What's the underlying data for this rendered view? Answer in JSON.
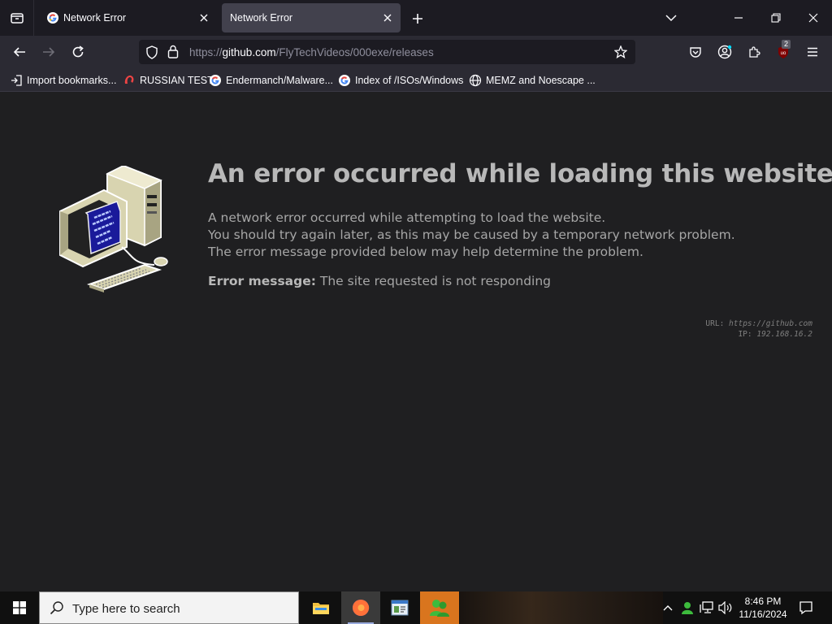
{
  "browser": {
    "tabs": [
      {
        "title": "Network Error",
        "active": false
      },
      {
        "title": "Network Error",
        "active": true
      }
    ],
    "url": {
      "scheme": "https://",
      "host": "github.com",
      "path": "/FlyTechVideos/000exe/releases"
    },
    "bookmarks": [
      {
        "label": "Import bookmarks...",
        "icon": "import-icon"
      },
      {
        "label": "RUSSIAN TEST",
        "icon": "site-icon"
      },
      {
        "label": "Endermanch/Malware...",
        "icon": "google-icon"
      },
      {
        "label": "Index of /ISOs/Windows",
        "icon": "google-icon"
      },
      {
        "label": "MEMZ and Noescape ...",
        "icon": "globe-icon"
      }
    ],
    "extension_badge": "2"
  },
  "error_page": {
    "heading": "An error occurred while loading this website",
    "lines": [
      "A network error occurred while attempting to load the website.",
      "You should try again later, as this may be caused by a temporary network problem.",
      "The error message provided below may help determine the problem."
    ],
    "error_label": "Error message:",
    "error_text": "The site requested is not responding",
    "url_label": "URL:",
    "url_value": "https://github.com",
    "ip_label": "IP:",
    "ip_value": "192.168.16.2"
  },
  "taskbar": {
    "search_placeholder": "Type here to search",
    "time": "8:46 PM",
    "date": "11/16/2024"
  },
  "colors": {
    "page_background": "#1f1f21",
    "heading": "#b8b8b8",
    "body_text": "#a6a6a6",
    "chrome_dark": "#1c1b22",
    "chrome_toolbar": "#2b2a33"
  }
}
